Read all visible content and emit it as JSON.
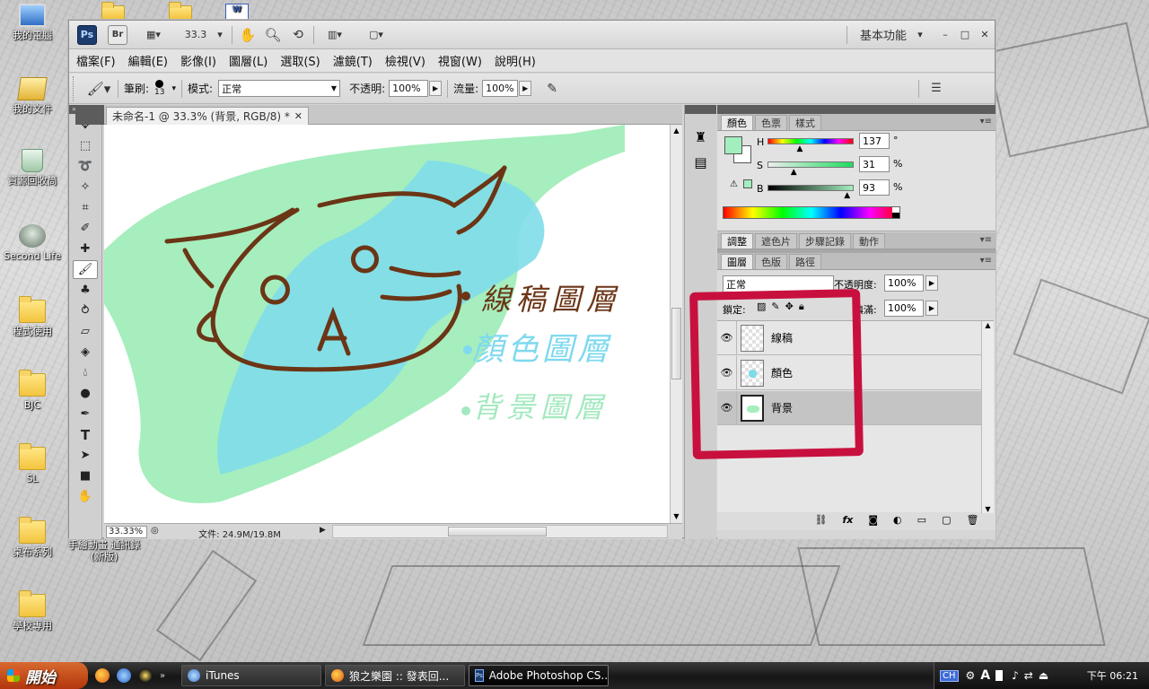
{
  "desktop": {
    "icons": [
      {
        "label": "我的電腦",
        "kind": "pc"
      },
      {
        "label": "我的文件",
        "kind": "docs"
      },
      {
        "label": "資源回收筒",
        "kind": "bin"
      },
      {
        "label": "Second Life",
        "kind": "sl"
      },
      {
        "label": "程式使用",
        "kind": "folder"
      },
      {
        "label": "BJC",
        "kind": "folder"
      },
      {
        "label": "SL",
        "kind": "folder"
      },
      {
        "label": "桌布系列",
        "kind": "folder"
      },
      {
        "label": "學校專用",
        "kind": "folder"
      },
      {
        "label": "手繪動畫 通訊錄(新版)",
        "kind": "file"
      }
    ]
  },
  "photoshop": {
    "app_logo": "Ps",
    "bridge_logo": "Br",
    "zoom_value": "33.3",
    "workspace": "基本功能",
    "menu": [
      "檔案(F)",
      "編輯(E)",
      "影像(I)",
      "圖層(L)",
      "選取(S)",
      "濾鏡(T)",
      "檢視(V)",
      "視窗(W)",
      "說明(H)"
    ],
    "options": {
      "brush_label": "筆刷:",
      "brush_size": "13",
      "mode_label": "模式:",
      "mode_value": "正常",
      "opacity_label": "不透明:",
      "opacity_value": "100%",
      "flow_label": "流量:",
      "flow_value": "100%"
    },
    "document": {
      "tab_title": "未命名-1 @ 33.3% (背景, RGB/8) *",
      "status_zoom": "33.33%",
      "status_file": "文件: 24.9M/19.8M",
      "canvas_labels": [
        "線稿圖層",
        "顏色圖層",
        "背景圖層"
      ],
      "canvas_label_colors": [
        "#6b3516",
        "#7fd9ef",
        "#a3e9bf"
      ]
    },
    "color_panel": {
      "tabs": [
        "顏色",
        "色票",
        "樣式"
      ],
      "h_label": "H",
      "s_label": "S",
      "b_label": "B",
      "h_value": "137",
      "s_value": "31",
      "b_value": "93",
      "h_unit": "°",
      "s_unit": "%",
      "b_unit": "%",
      "foreground": "#a3eebf"
    },
    "adjust_tabs": [
      "調整",
      "遮色片",
      "步驟記錄",
      "動作"
    ],
    "layers_panel": {
      "tabs": [
        "圖層",
        "色版",
        "路徑"
      ],
      "blend_value": "正常",
      "opacity_label": "不透明度:",
      "opacity_value": "100%",
      "lock_label": "鎖定:",
      "fill_label": "填滿:",
      "fill_value": "100%",
      "layers": [
        {
          "name": "線稿",
          "selected": false
        },
        {
          "name": "顏色",
          "selected": false
        },
        {
          "name": "背景",
          "selected": true
        }
      ]
    }
  },
  "taskbar": {
    "start_label": "開始",
    "tasks": [
      "iTunes",
      "狼之樂園 :: 發表回...",
      "Adobe Photoshop CS..."
    ],
    "lang": "CH",
    "clock": "下午 06:21"
  },
  "colors": {
    "highlight_box": "#c8103e",
    "brown": "#6b3516",
    "cyan": "#7fdde9",
    "green": "#a6eebd"
  }
}
